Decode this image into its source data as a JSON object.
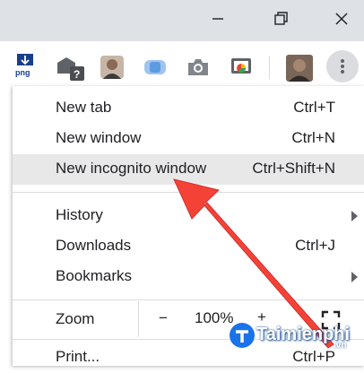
{
  "colors": {
    "titlebar": "#dee1e6",
    "menu_highlight": "#e8e8e9",
    "separator": "#dadce0",
    "annotation_arrow": "#f44336",
    "watermark_accent": "#1a73e8"
  },
  "window_controls": [
    "minimize-icon",
    "restore-icon",
    "close-icon"
  ],
  "toolbar": {
    "extensions": [
      {
        "icon": "png-download-icon",
        "label": "png"
      },
      {
        "icon": "puzzle-help-icon",
        "label": "?"
      },
      {
        "icon": "profile-photo-extension-icon"
      },
      {
        "icon": "blue-extension-icon"
      },
      {
        "icon": "camera-icon"
      },
      {
        "icon": "cast-presentation-icon"
      }
    ],
    "avatar": "profile-avatar",
    "menu_button": "kebab-menu-icon"
  },
  "menu": {
    "items": [
      {
        "label": "New tab",
        "shortcut": "Ctrl+T"
      },
      {
        "label": "New window",
        "shortcut": "Ctrl+N"
      },
      {
        "label": "New incognito window",
        "shortcut": "Ctrl+Shift+N",
        "highlighted": true
      },
      {
        "label": "History",
        "submenu": true
      },
      {
        "label": "Downloads",
        "shortcut": "Ctrl+J"
      },
      {
        "label": "Bookmarks",
        "submenu": true
      },
      {
        "label": "Print...",
        "shortcut": "Ctrl+P"
      }
    ],
    "zoom": {
      "label": "Zoom",
      "minus": "−",
      "value": "100%",
      "plus": "+",
      "fullscreen_icon": "fullscreen-icon"
    }
  },
  "watermark": {
    "text": "Taimienphi",
    "suffix": ".vn"
  }
}
